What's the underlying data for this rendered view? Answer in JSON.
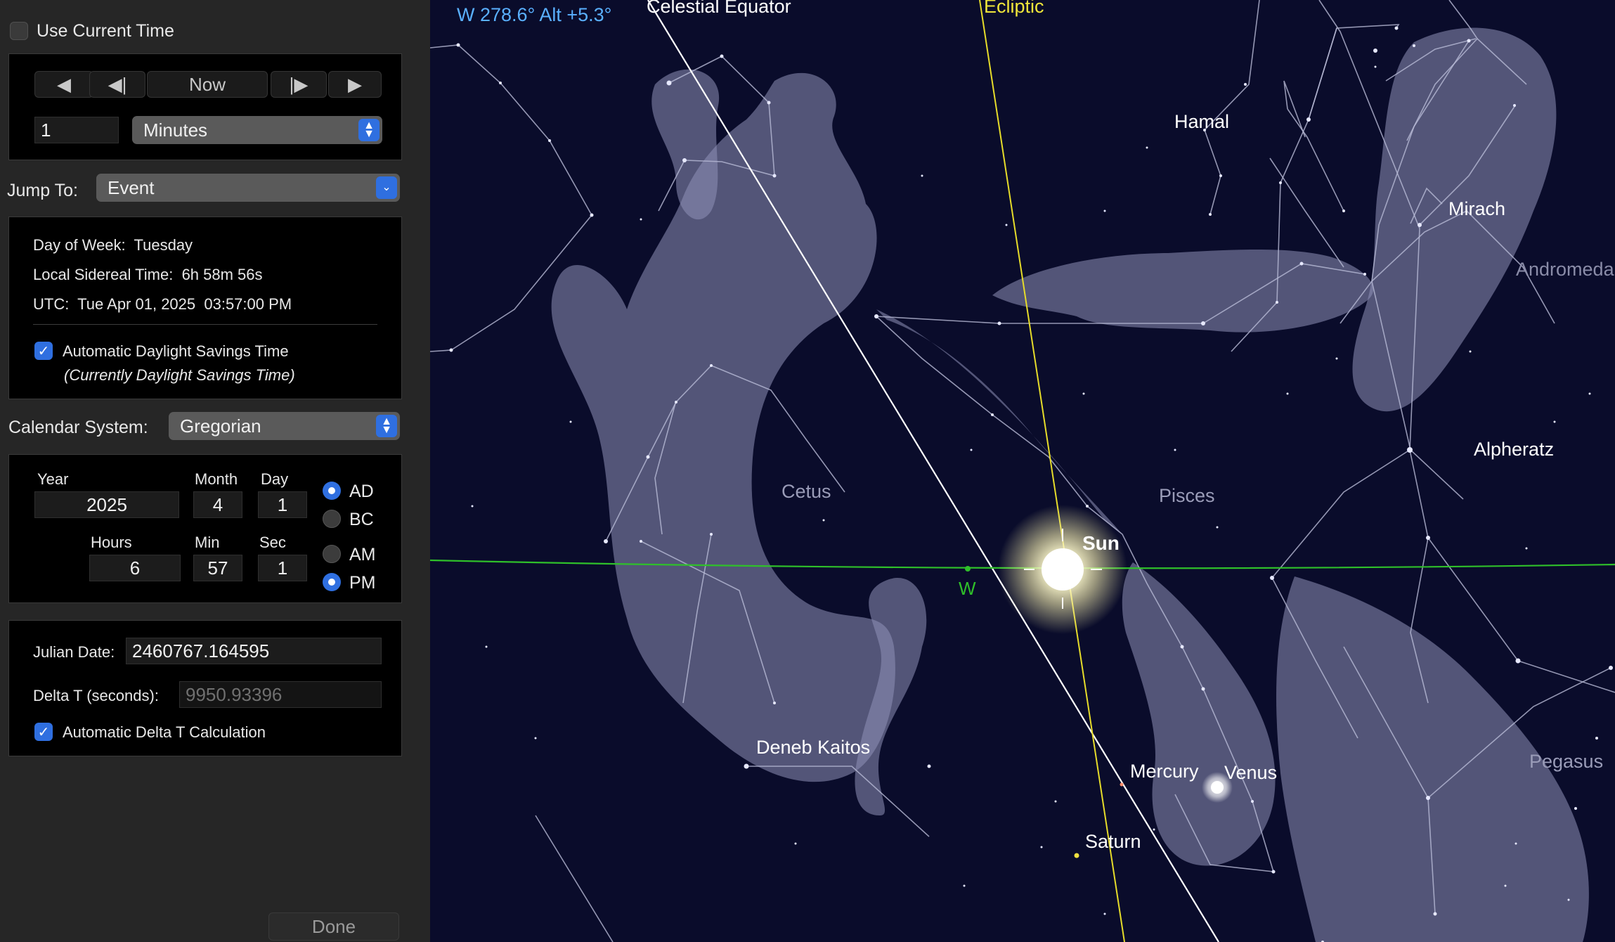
{
  "panel": {
    "use_current_time": {
      "label": "Use Current Time",
      "checked": false
    },
    "step_buttons": {
      "now": "Now",
      "back_icon": "play-back-icon",
      "step_back_icon": "step-back-icon",
      "step_fwd_icon": "step-forward-icon",
      "fwd_icon": "play-forward-icon"
    },
    "step_amount": "1",
    "step_unit": "Minutes",
    "jump_to": {
      "label": "Jump To:",
      "value": "Event"
    },
    "info": {
      "day_of_week_label": "Day of Week:",
      "day_of_week": "Tuesday",
      "lst_label": "Local Sidereal Time:",
      "lst": "6h 58m 56s",
      "utc_label": "UTC:",
      "utc": "Tue Apr 01, 2025  03:57:00 PM",
      "auto_dst": {
        "label": "Automatic Daylight Savings Time",
        "checked": true
      },
      "dst_note": "(Currently Daylight Savings Time)"
    },
    "calendar": {
      "label": "Calendar System:",
      "value": "Gregorian"
    },
    "date": {
      "year_label": "Year",
      "year": "2025",
      "month_label": "Month",
      "month": "4",
      "day_label": "Day",
      "day": "1",
      "hours_label": "Hours",
      "hours": "6",
      "min_label": "Min",
      "min": "57",
      "sec_label": "Sec",
      "sec": "1",
      "ad": "AD",
      "bc": "BC",
      "am": "AM",
      "pm": "PM",
      "era_selected": "AD",
      "meridiem_selected": "PM"
    },
    "julian": {
      "label": "Julian Date:",
      "value": "2460767.164595",
      "delta_label": "Delta T (seconds):",
      "delta_value": "9950.93396",
      "auto_delta": {
        "label": "Automatic Delta T Calculation",
        "checked": true
      }
    },
    "done": "Done"
  },
  "sky": {
    "readout": "W 278.6° Alt +5.3°",
    "lines": {
      "celestial_equator": "Celestial Equator",
      "ecliptic": "Ecliptic",
      "horizon_w": "W"
    },
    "stars": {
      "hamal": "Hamal",
      "mirach": "Mirach",
      "alpheratz": "Alpheratz",
      "deneb_kaitos": "Deneb Kaitos"
    },
    "constellations": {
      "andromeda": "Andromeda",
      "cetus": "Cetus",
      "pisces": "Pisces",
      "pegasus": "Pegasus"
    },
    "planets": {
      "sun": "Sun",
      "mercury": "Mercury",
      "venus": "Venus",
      "saturn": "Saturn"
    },
    "colors": {
      "sky": "#0a0c2b",
      "readout": "#5ab0ff",
      "ecliptic": "#e6dc2a",
      "horizon": "#2fc02a",
      "equator": "#ffffff",
      "accent": "#2f6fe0"
    }
  }
}
